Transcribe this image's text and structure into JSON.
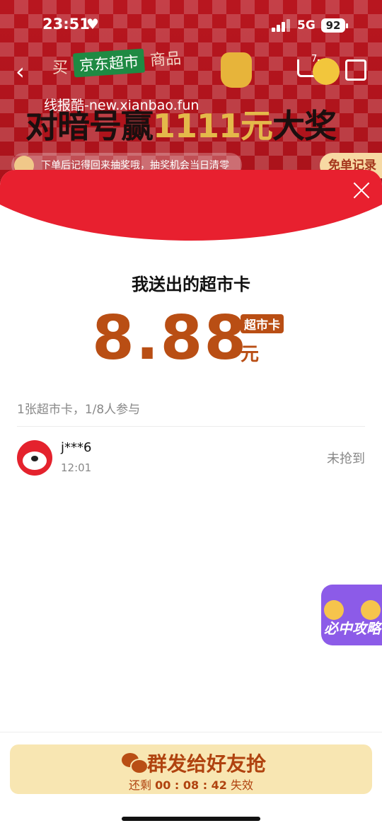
{
  "status_bar": {
    "time": "23:51",
    "network": "5G",
    "battery": "92"
  },
  "header": {
    "buy_prefix": "买",
    "jd_badge": "京东超市",
    "buy_suffix": "商品",
    "cart_count": "7",
    "watermark": "线报酷-new.xianbao.fun",
    "headline_a": "对暗号赢",
    "headline_gold": "1111元",
    "headline_b": "大奖",
    "notice": "下单后记得回来抽奖哦，抽奖机会当日清零",
    "free_record": "免单记录"
  },
  "sheet": {
    "title": "我送出的超市卡",
    "amount": "8.88",
    "card_tag": "超市卡",
    "currency": "元",
    "summary": "1张超市卡，1/8人参与",
    "records": [
      {
        "user": "j***6",
        "time": "12:01",
        "status": "未抢到"
      }
    ]
  },
  "floating_tip": {
    "label": "必中攻略"
  },
  "cta": {
    "main": "群发给好友抢",
    "remaining_prefix": "还剩",
    "countdown": "00 : 08 : 42",
    "remaining_suffix": "失效"
  },
  "colors": {
    "accent_red": "#e8202f",
    "brand_brown": "#b94e14",
    "cta_bg": "#f8e6b2"
  }
}
